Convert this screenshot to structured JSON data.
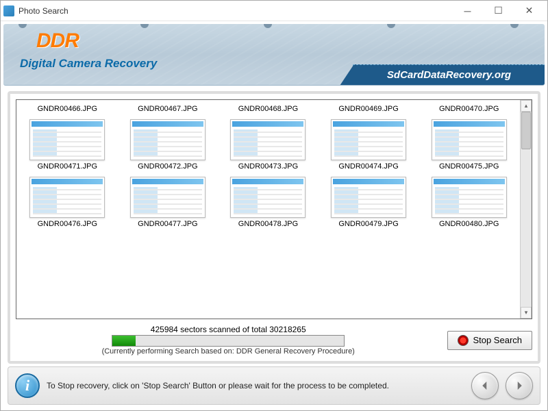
{
  "titlebar": {
    "title": "Photo Search"
  },
  "banner": {
    "logo": "DDR",
    "subtitle": "Digital Camera Recovery",
    "site": "SdCardDataRecovery.org"
  },
  "items": [
    {
      "name": "GNDR00466.JPG"
    },
    {
      "name": "GNDR00467.JPG"
    },
    {
      "name": "GNDR00468.JPG"
    },
    {
      "name": "GNDR00469.JPG"
    },
    {
      "name": "GNDR00470.JPG"
    },
    {
      "name": "GNDR00471.JPG"
    },
    {
      "name": "GNDR00472.JPG"
    },
    {
      "name": "GNDR00473.JPG"
    },
    {
      "name": "GNDR00474.JPG"
    },
    {
      "name": "GNDR00475.JPG"
    },
    {
      "name": "GNDR00476.JPG"
    },
    {
      "name": "GNDR00477.JPG"
    },
    {
      "name": "GNDR00478.JPG"
    },
    {
      "name": "GNDR00479.JPG"
    },
    {
      "name": "GNDR00480.JPG"
    }
  ],
  "progress": {
    "status": "425984 sectors scanned of total 30218265",
    "sub": "(Currently performing Search based on:  DDR General Recovery Procedure)",
    "stop_label": "Stop Search"
  },
  "footer": {
    "hint": "To Stop recovery, click on 'Stop Search' Button or please wait for the process to be completed."
  }
}
